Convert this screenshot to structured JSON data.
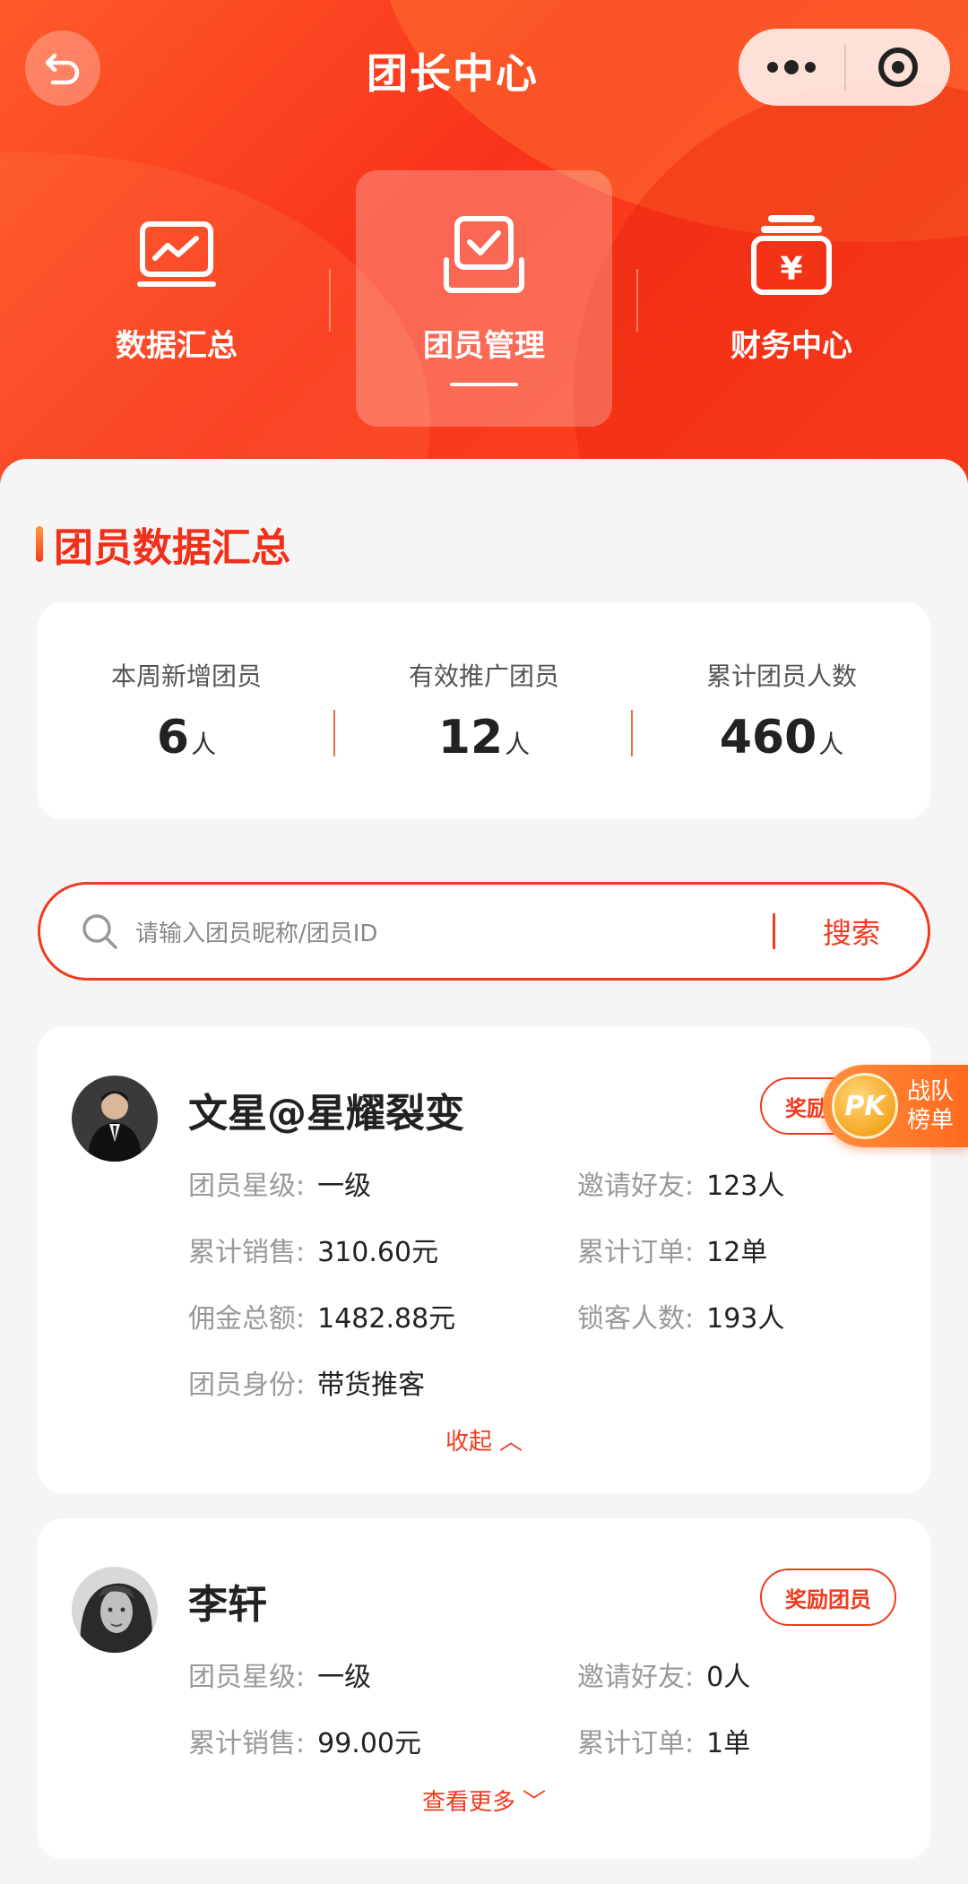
{
  "header": {
    "title": "团长中心",
    "back_icon": "back-arrow-icon"
  },
  "nav": [
    {
      "label": "数据汇总",
      "icon": "chart-monitor-icon",
      "active": false
    },
    {
      "label": "团员管理",
      "icon": "checkbox-tray-icon",
      "active": true
    },
    {
      "label": "财务中心",
      "icon": "yuan-wallet-icon",
      "active": false
    }
  ],
  "section": {
    "title": "团员数据汇总"
  },
  "stats": [
    {
      "label": "本周新增团员",
      "value": "6",
      "unit": "人"
    },
    {
      "label": "有效推广团员",
      "value": "12",
      "unit": "人"
    },
    {
      "label": "累计团员人数",
      "value": "460",
      "unit": "人"
    }
  ],
  "search": {
    "placeholder": "请输入团员昵称/团员ID",
    "button": "搜索"
  },
  "members": [
    {
      "name": "文星@星耀裂变",
      "reward_button": "奖励团员",
      "fields": [
        {
          "k": "团员星级:",
          "v": "一级"
        },
        {
          "k": "邀请好友:",
          "v": "123人"
        },
        {
          "k": "累计销售:",
          "v": "310.60元"
        },
        {
          "k": "累计订单:",
          "v": "12单"
        },
        {
          "k": "佣金总额:",
          "v": "1482.88元"
        },
        {
          "k": "锁客人数:",
          "v": "193人"
        },
        {
          "k": "团员身份:",
          "v": "带货推客"
        }
      ],
      "toggle": "收起"
    },
    {
      "name": "李轩",
      "reward_button": "奖励团员",
      "fields": [
        {
          "k": "团员星级:",
          "v": "一级"
        },
        {
          "k": "邀请好友:",
          "v": "0人"
        },
        {
          "k": "累计销售:",
          "v": "99.00元"
        },
        {
          "k": "累计订单:",
          "v": "1单"
        }
      ],
      "toggle": "查看更多"
    }
  ],
  "pk_float": {
    "badge": "PK",
    "line1": "战队",
    "line2": "榜单"
  },
  "colors": {
    "accent": "#f23a1e",
    "hero": "#f8331a"
  }
}
